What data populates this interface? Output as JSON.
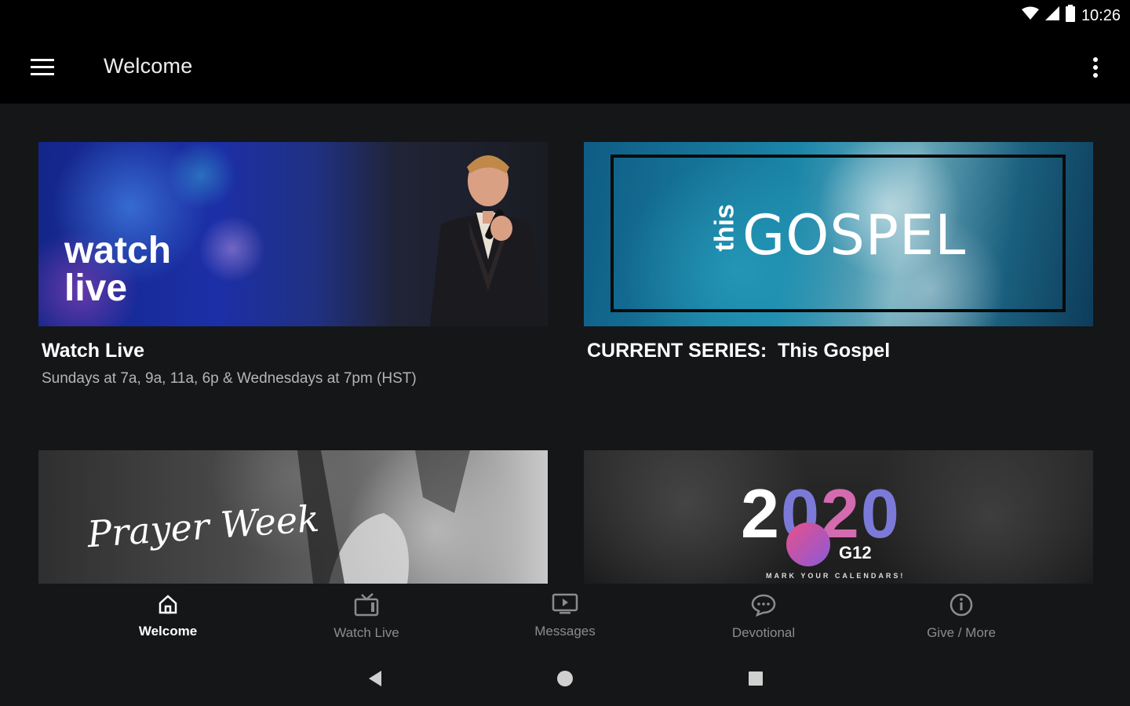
{
  "status_bar": {
    "time": "10:26",
    "icons": [
      "wifi-icon",
      "signal-icon",
      "battery-icon"
    ]
  },
  "app_bar": {
    "title": "Welcome",
    "menu_icon": "hamburger-menu-icon",
    "overflow_icon": "more-vert-icon"
  },
  "cards": {
    "watch_live": {
      "image_text": [
        "watch",
        "live"
      ],
      "title": "Watch Live",
      "subtitle": "Sundays at 7a, 9a, 11a, 6p & Wednesdays at 7pm (HST)"
    },
    "current_series": {
      "logo_small": "this",
      "logo_large": "GOSPEL",
      "title": "CURRENT SERIES:  This Gospel"
    },
    "prayer_week": {
      "image_text": "Prayer Week"
    },
    "event_2020": {
      "year_parts": [
        "2",
        "0",
        "2",
        "0"
      ],
      "badge": "G12",
      "tagline": "MARK YOUR CALENDARS!"
    }
  },
  "bottom_nav": {
    "items": [
      {
        "label": "Welcome",
        "icon": "home-icon",
        "active": true
      },
      {
        "label": "Watch Live",
        "icon": "tv-icon",
        "active": false
      },
      {
        "label": "Messages",
        "icon": "monitor-play-icon",
        "active": false
      },
      {
        "label": "Devotional",
        "icon": "chat-bubble-icon",
        "active": false
      },
      {
        "label": "Give / More",
        "icon": "info-icon",
        "active": false
      }
    ]
  },
  "system_nav": {
    "icons": [
      "back-icon",
      "home-circle-icon",
      "recents-icon"
    ]
  },
  "colors": {
    "background": "#151618",
    "app_bar": "#000000",
    "active_nav": "#ffffff",
    "inactive_nav": "#8c8c8c"
  }
}
